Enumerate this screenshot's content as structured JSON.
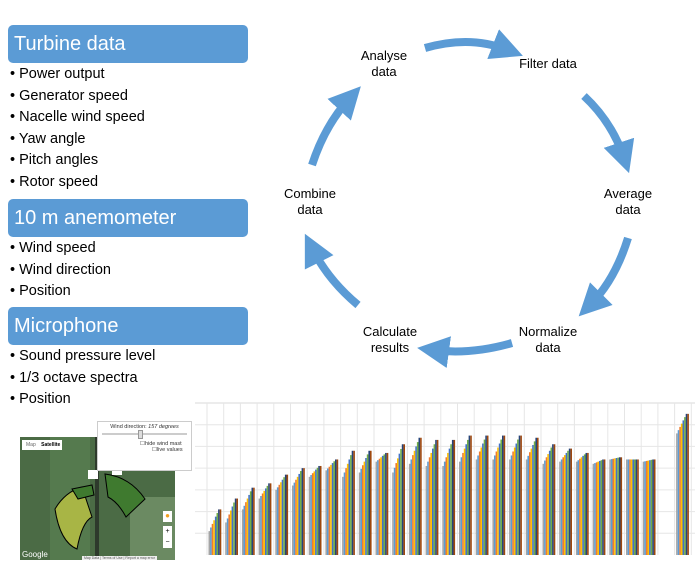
{
  "sections": [
    {
      "title": "Turbine data",
      "items": [
        "Power output",
        "Generator speed",
        "Nacelle wind speed",
        "Yaw angle",
        "Pitch angles",
        "Rotor speed"
      ]
    },
    {
      "title": "10 m anemometer",
      "items": [
        "Wind speed",
        "Wind direction",
        "Position"
      ]
    },
    {
      "title": "Microphone",
      "items": [
        "Sound pressure level",
        "1/3 octave spectra",
        "Position"
      ]
    }
  ],
  "cycle": {
    "steps": [
      "Analyse\ndata",
      "Filter data",
      "Average\ndata",
      "Normalize\ndata",
      "Calculate\nresults",
      "Combine\ndata"
    ],
    "color": "#5b9bd5"
  },
  "map": {
    "tabs": [
      "Map",
      "Satellite"
    ],
    "wind_direction_label": "Wind direction:",
    "wind_direction_value": "157 degrees",
    "hide_label": "hide wind mast",
    "live_label": "live values",
    "google": "Google",
    "footer": "Map Data | Terms of Use | Report a map error",
    "zoom_in": "+",
    "zoom_out": "−"
  },
  "chart_data": {
    "type": "bar",
    "grid": true,
    "series_colors": [
      "#a5a5a5",
      "#5b9bd5",
      "#ed7d31",
      "#ffc000",
      "#4472c4",
      "#70ad47",
      "#264478",
      "#9e480e"
    ],
    "groups": [
      [
        1.1,
        2.1
      ],
      [
        1.5,
        2.6
      ],
      [
        2.1,
        3.1
      ],
      [
        2.6,
        3.3
      ],
      [
        3.0,
        3.7
      ],
      [
        3.2,
        4.0
      ],
      [
        3.6,
        4.1
      ],
      [
        3.9,
        4.4
      ],
      [
        3.6,
        4.8
      ],
      [
        3.8,
        4.8
      ],
      [
        4.3,
        4.7
      ],
      [
        3.8,
        5.1
      ],
      [
        4.2,
        5.4
      ],
      [
        4.1,
        5.3
      ],
      [
        4.1,
        5.3
      ],
      [
        4.3,
        5.5
      ],
      [
        4.4,
        5.5
      ],
      [
        4.4,
        5.5
      ],
      [
        4.4,
        5.5
      ],
      [
        4.4,
        5.4
      ],
      [
        4.2,
        5.1
      ],
      [
        4.3,
        4.9
      ],
      [
        4.3,
        4.7
      ],
      [
        4.2,
        4.4
      ],
      [
        4.4,
        4.5
      ],
      [
        4.4,
        4.4
      ],
      [
        4.3,
        4.4
      ],
      null,
      [
        5.6,
        6.5
      ]
    ],
    "ylim": [
      0,
      7
    ]
  }
}
